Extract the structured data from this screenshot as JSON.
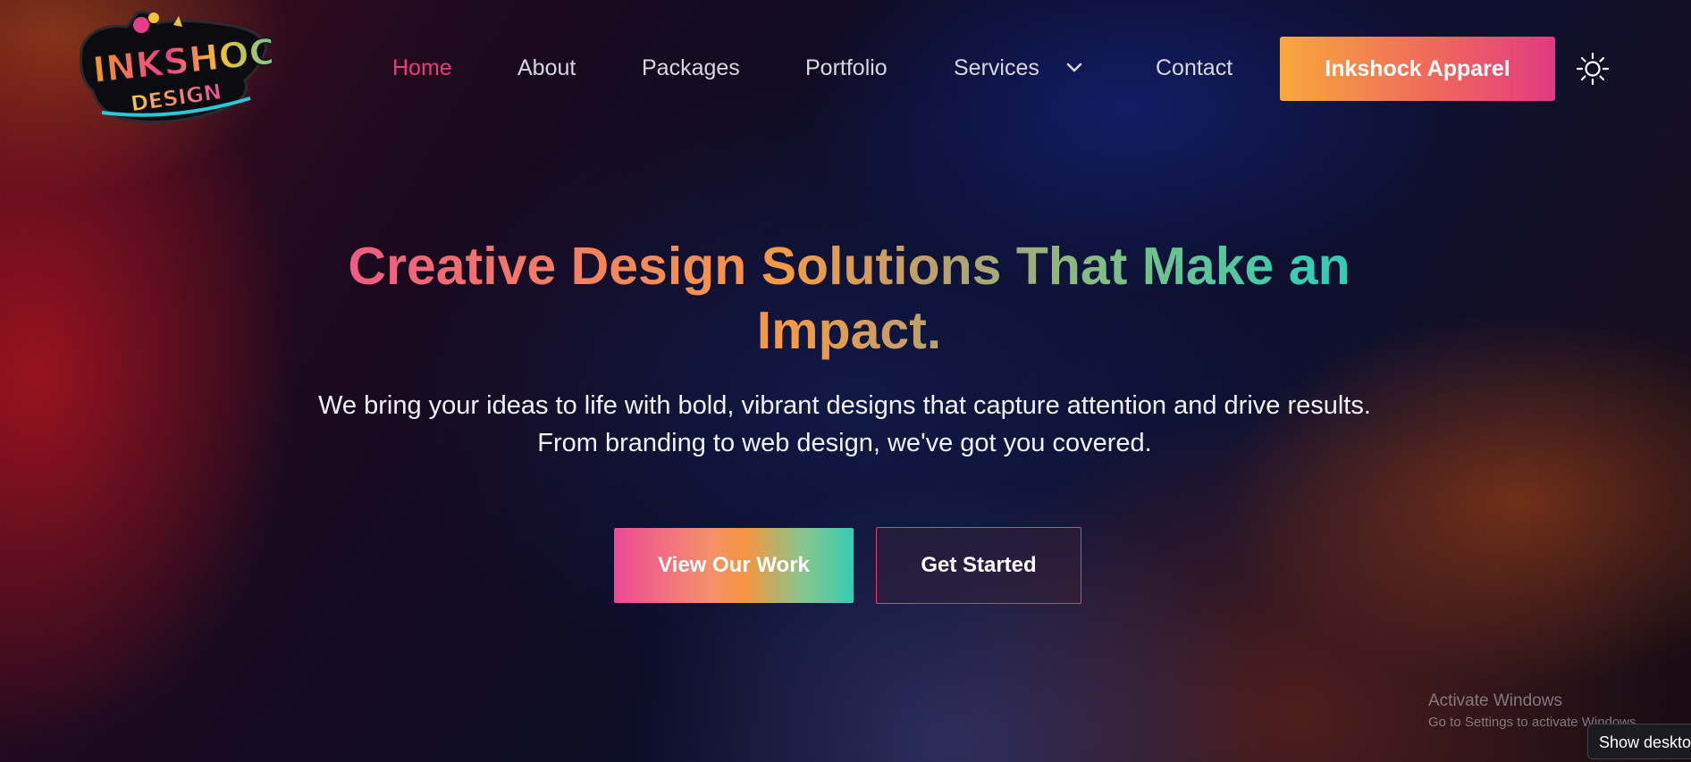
{
  "header": {
    "logo": {
      "line1": "INKSHOCK",
      "line2": "DESIGN"
    },
    "nav": [
      {
        "label": "Home",
        "active": true
      },
      {
        "label": "About",
        "active": false
      },
      {
        "label": "Packages",
        "active": false
      },
      {
        "label": "Portfolio",
        "active": false
      },
      {
        "label": "Services",
        "active": false,
        "has_dropdown": true
      },
      {
        "label": "Contact",
        "active": false
      }
    ],
    "cta_label": "Inkshock Apparel",
    "theme_icon": "sun-icon"
  },
  "hero": {
    "title": "Creative Design Solutions That Make an Impact.",
    "subtitle": "We bring your ideas to life with bold, vibrant designs that capture attention and drive results. From branding to web design, we've got you covered.",
    "primary_button": "View Our Work",
    "secondary_button": "Get Started"
  },
  "os_overlay": {
    "watermark_title": "Activate Windows",
    "watermark_sub": "Go to Settings to activate Windows.",
    "show_desktop": "Show desktop"
  },
  "colors": {
    "active_nav": "#ec3a7a",
    "cta_gradient_start": "#f8a83e",
    "cta_gradient_end": "#e23a82",
    "secondary_border": "#e0407a"
  }
}
